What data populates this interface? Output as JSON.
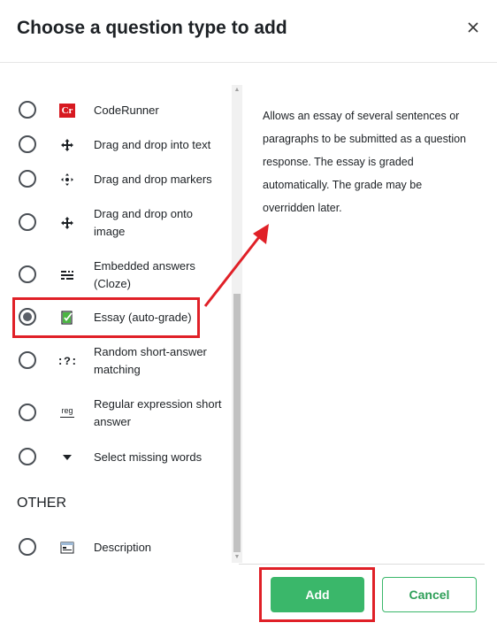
{
  "dialog": {
    "title": "Choose a question type to add",
    "close_icon": "close-icon"
  },
  "question_types": [
    {
      "label": "CodeRunner",
      "icon": "coderunner-icon",
      "icon_text": "Cr",
      "selected": false
    },
    {
      "label": "Drag and drop into text",
      "icon": "drag-drop-text-icon",
      "selected": false
    },
    {
      "label": "Drag and drop markers",
      "icon": "drag-drop-markers-icon",
      "selected": false
    },
    {
      "label": "Drag and drop onto image",
      "icon": "drag-drop-image-icon",
      "selected": false
    },
    {
      "label": "Embedded answers (Cloze)",
      "icon": "cloze-icon",
      "selected": false
    },
    {
      "label": "Essay (auto-grade)",
      "icon": "essay-autograde-icon",
      "selected": true
    },
    {
      "label": "Random short-answer matching",
      "icon": "random-matching-icon",
      "icon_text": ":?:",
      "selected": false
    },
    {
      "label": "Regular expression short answer",
      "icon": "regex-icon",
      "icon_text": "reg",
      "selected": false
    },
    {
      "label": "Select missing words",
      "icon": "dropdown-triangle-icon",
      "selected": false
    }
  ],
  "other_section": {
    "heading": "OTHER",
    "items": [
      {
        "label": "Description",
        "icon": "description-icon",
        "selected": false
      }
    ]
  },
  "description": "Allows an essay of several sentences or paragraphs to be submitted as a question response. The essay is graded automatically. The grade may be overridden later.",
  "footer": {
    "add_label": "Add",
    "cancel_label": "Cancel"
  },
  "colors": {
    "accent_green": "#3ab76a",
    "highlight_red": "#e02027",
    "coderunner_red": "#d71920"
  }
}
